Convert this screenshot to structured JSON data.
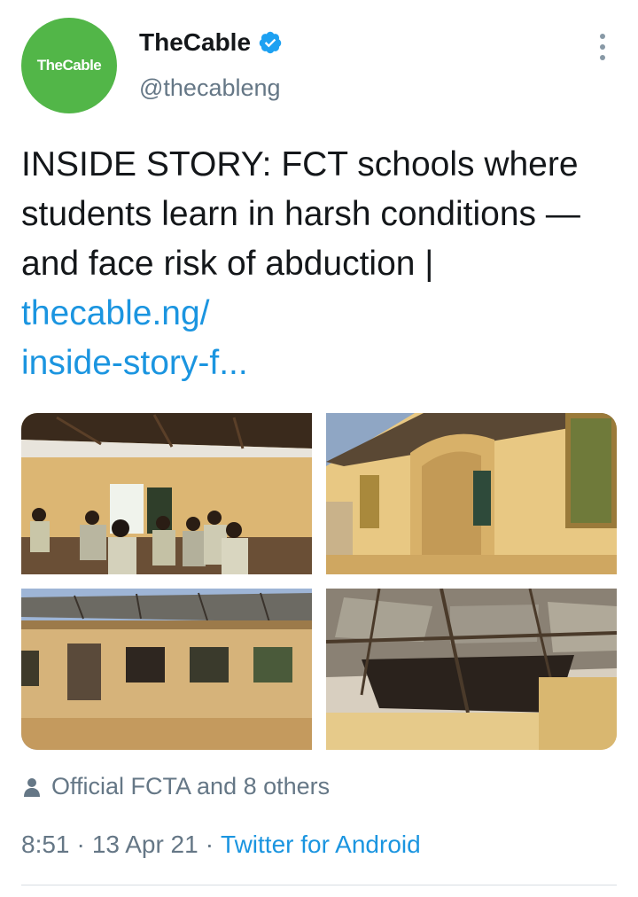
{
  "account": {
    "display_name": "TheCable",
    "handle": "@thecableng",
    "avatar_text": "TheCable",
    "verified": true
  },
  "tweet": {
    "text": "INSIDE STORY: FCT schools where students learn in harsh conditions — and face risk of abduction | ",
    "link_text": "thecable.ng/\ninside-story-f...",
    "link_line1": "thecable.ng/",
    "link_line2": "inside-story-f..."
  },
  "media": {
    "count": 4,
    "photos": [
      "classroom-with-students",
      "school-building-exterior",
      "damaged-roof-building",
      "collapsed-ceiling"
    ]
  },
  "engagement": {
    "likes_text": "Official FCTA and 8 others"
  },
  "meta": {
    "time": "8:51",
    "date": "13 Apr 21",
    "separator": "·",
    "source": "Twitter for Android"
  },
  "colors": {
    "avatar_bg": "#52b648",
    "link": "#1b95e0",
    "secondary_text": "#657786",
    "verified": "#1da1f2"
  },
  "icons": [
    "verified-badge-icon",
    "more-options-icon",
    "person-icon"
  ]
}
